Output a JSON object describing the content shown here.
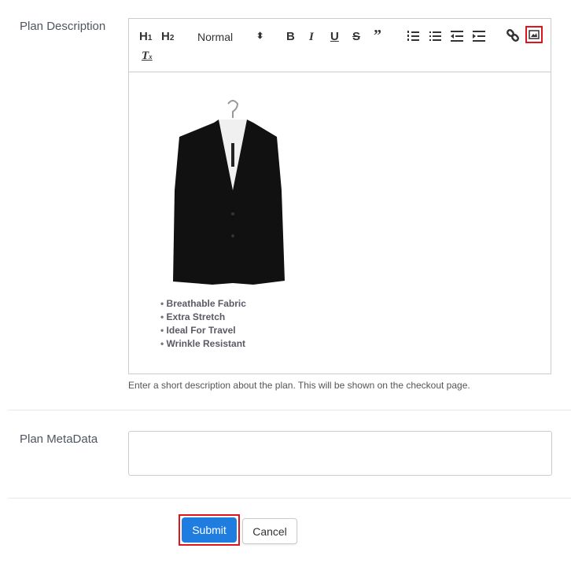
{
  "plan_description": {
    "label": "Plan Description",
    "toolbar": {
      "h1": "H1",
      "h2": "H2",
      "format_select": "Normal",
      "icons": [
        "bold-icon",
        "italic-icon",
        "underline-icon",
        "strikethrough-icon",
        "blockquote-icon",
        "ordered-list-icon",
        "bullet-list-icon",
        "outdent-icon",
        "indent-icon",
        "link-icon",
        "image-icon",
        "clear-format-icon"
      ]
    },
    "content": {
      "image_alt": "Black suit jacket on hanger",
      "bullets": [
        "Breathable Fabric",
        "Extra Stretch",
        "Ideal For Travel",
        "Wrinkle Resistant"
      ]
    },
    "help_text": "Enter a short description about the plan. This will be shown on the checkout page."
  },
  "plan_metadata": {
    "label": "Plan MetaData",
    "value": ""
  },
  "actions": {
    "submit": "Submit",
    "cancel": "Cancel"
  },
  "highlight_color": "#e0141c",
  "accent_color": "#1f7de0"
}
